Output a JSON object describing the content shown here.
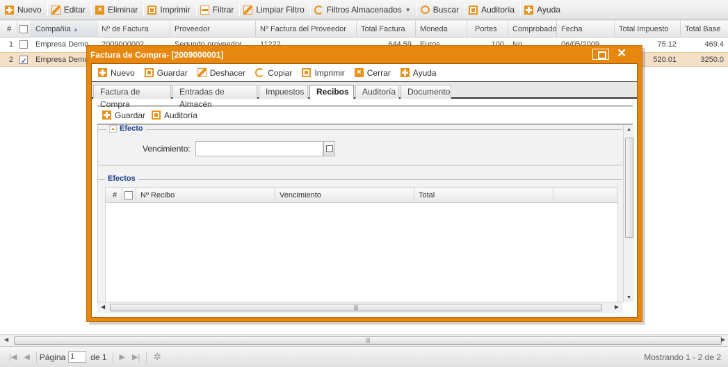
{
  "toolbar": {
    "items": [
      {
        "label": "Nuevo",
        "icon": "plus-icon"
      },
      {
        "label": "Editar",
        "icon": "edit-icon"
      },
      {
        "label": "Eliminar",
        "icon": "delete-icon"
      },
      {
        "label": "Imprimir",
        "icon": "print-icon"
      },
      {
        "label": "Filtrar",
        "icon": "filter-icon"
      },
      {
        "label": "Limpiar Filtro",
        "icon": "clear-filter-icon"
      },
      {
        "label": "Filtros Almacenados",
        "icon": "stored-filters-icon"
      },
      {
        "label": "Buscar",
        "icon": "search-icon"
      },
      {
        "label": "Auditoría",
        "icon": "audit-icon"
      },
      {
        "label": "Ayuda",
        "icon": "help-icon"
      }
    ]
  },
  "grid": {
    "columns": [
      "#",
      "Compañía",
      "Nº de Factura",
      "Proveedor",
      "Nº Factura del Proveedor",
      "Total Factura",
      "Moneda",
      "Portes",
      "Comprobado",
      "Fecha",
      "Total Impuesto",
      "Total Base"
    ],
    "rows": [
      {
        "num": "1",
        "checked": false,
        "company": "Empresa Demo",
        "invoice": "2009000002",
        "supplier": "Segundo proveedor",
        "supplier_invoice": "11222",
        "total": "644.59",
        "currency": "Euros",
        "shipping": "100",
        "checked_text": "No",
        "date": "06/05/2009",
        "tax": "75.12",
        "base": "469.4"
      },
      {
        "num": "2",
        "checked": true,
        "company": "Empresa Demo",
        "invoice": "",
        "supplier": "",
        "supplier_invoice": "",
        "total": "",
        "currency": "",
        "shipping": "",
        "checked_text": "",
        "date": "",
        "tax": "520.01",
        "base": "3250.0"
      }
    ]
  },
  "paging": {
    "page_label": "Página",
    "page_value": "1",
    "of_label": "de 1",
    "showing": "Mostrando 1 - 2 de 2"
  },
  "modal": {
    "title": "Factura de Compra- [2009000001]",
    "toolbar": [
      {
        "label": "Nuevo"
      },
      {
        "label": "Guardar"
      },
      {
        "label": "Deshacer"
      },
      {
        "label": "Copiar"
      },
      {
        "label": "Imprimir"
      },
      {
        "label": "Cerrar"
      },
      {
        "label": "Ayuda"
      }
    ],
    "tabs": [
      "Factura de Compra",
      "Entradas de Almacén",
      "Impuestos",
      "Recibos",
      "Auditoría",
      "Documento"
    ],
    "active_tab": "Recibos",
    "sub_toolbar": {
      "save": "Guardar",
      "audit": "Auditoría"
    },
    "efecto_legend": "Efecto",
    "vencimiento_label": "Vencimiento:",
    "vencimiento_value": "",
    "efectos_legend": "Efectos",
    "efectos_columns": [
      "#",
      "Nº Recibo",
      "Vencimiento",
      "Total"
    ]
  },
  "colors": {
    "accent": "#e8921c",
    "selected_row": "#f4dfc7",
    "legend_text": "#1a3f8a"
  }
}
